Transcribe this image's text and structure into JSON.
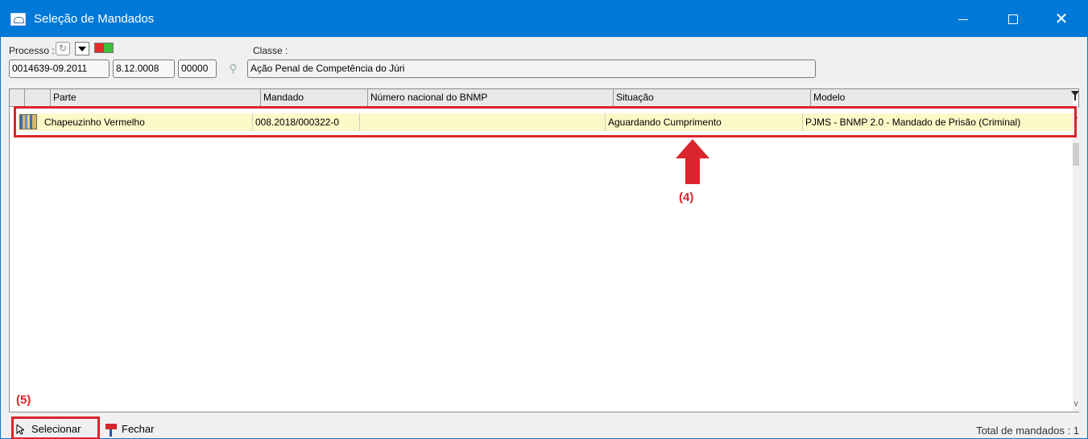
{
  "window": {
    "title": "Seleção de Mandados"
  },
  "header": {
    "processo_label": "Processo :",
    "classe_label": "Classe :",
    "processo_parts": [
      "0014639-09.2011",
      "8.12.0008",
      "00000"
    ],
    "classe_value": "Ação Penal de Competência do Júri"
  },
  "grid": {
    "columns": [
      "Parte",
      "Mandado",
      "Número nacional do BNMP",
      "Situação",
      "Modelo"
    ],
    "rows": [
      {
        "parte": "Chapeuzinho Vermelho",
        "mandado": "008.2018/000322-0",
        "bnmp": "",
        "situacao": "Aguardando Cumprimento",
        "modelo": "PJMS - BNMP 2.0 - Mandado de Prisão (Criminal)"
      }
    ]
  },
  "annotations": {
    "label4": "(4)",
    "label5": "(5)",
    "color": "#d9252b"
  },
  "footer": {
    "selecionar_label": "Selecionar",
    "fechar_label": "Fechar",
    "total": "Total de mandados : 1"
  },
  "icons": {
    "app": "window-app-icon",
    "refresh": "refresh-icon",
    "dropdown": "caret-down-icon",
    "status": "red-green-status-icon",
    "search": "search-icon",
    "filter": "filter-icon",
    "cursor": "cursor-icon",
    "close_door": "fechar-icon"
  }
}
